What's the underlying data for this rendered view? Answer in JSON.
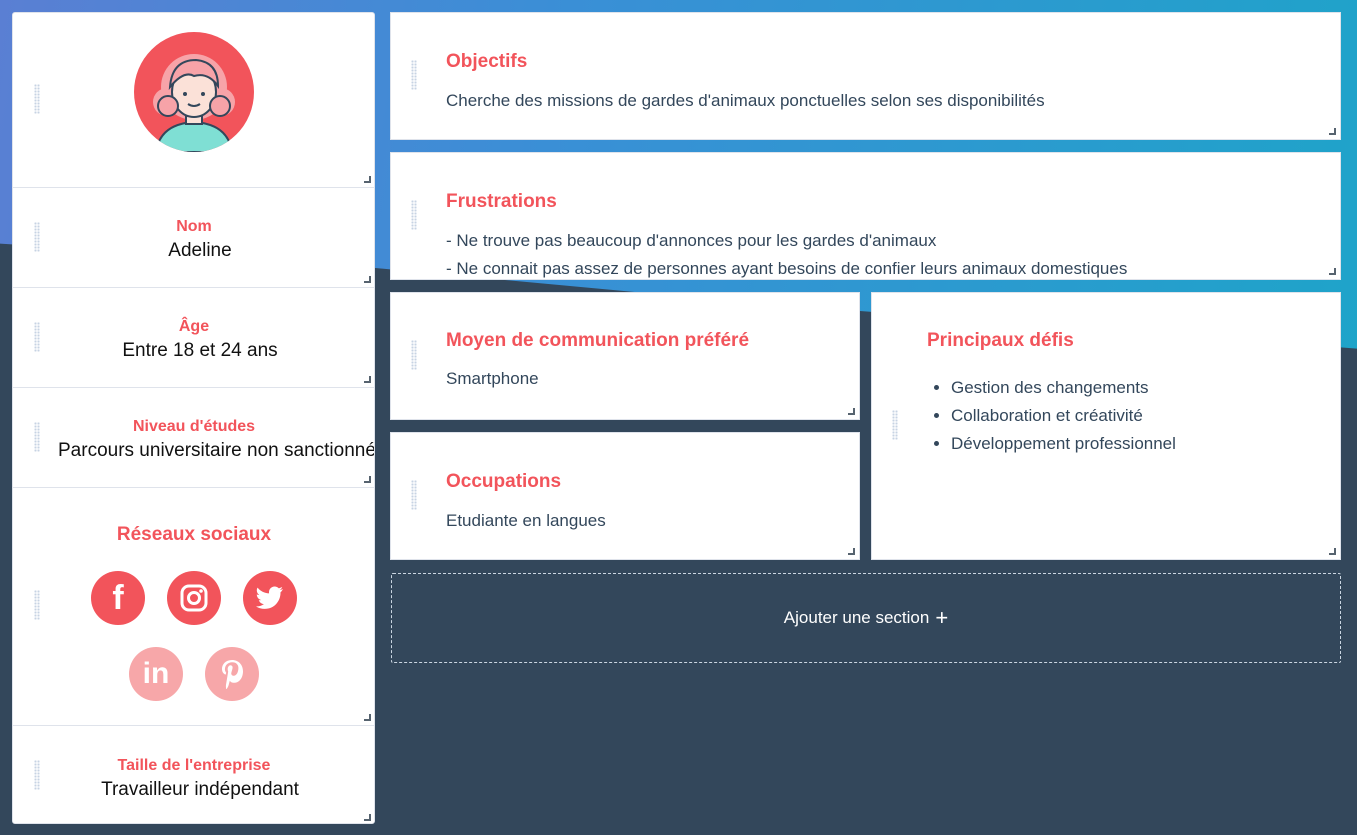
{
  "profile": {
    "avatar_icon": "woman-avatar-icon",
    "name_label": "Nom",
    "name_value": "Adeline",
    "age_label": "Âge",
    "age_value": "Entre 18 et 24 ans",
    "education_label": "Niveau d'études",
    "education_value": "Parcours universitaire non sanctionné",
    "social_label": "Réseaux sociaux",
    "social_networks": [
      {
        "name": "facebook",
        "glyph": "f",
        "active": true
      },
      {
        "name": "instagram",
        "glyph": "◎",
        "active": true
      },
      {
        "name": "twitter",
        "glyph": "🐦",
        "active": true
      },
      {
        "name": "linkedin",
        "glyph": "in",
        "active": false
      },
      {
        "name": "pinterest",
        "glyph": "p",
        "active": false
      }
    ],
    "company_label": "Taille de l'entreprise",
    "company_value": "Travailleur indépendant"
  },
  "sections": {
    "objectives": {
      "title": "Objectifs",
      "text": "Cherche des missions de gardes d'animaux ponctuelles selon ses disponibilités"
    },
    "frustrations": {
      "title": "Frustrations",
      "lines": [
        "- Ne trouve pas beaucoup d'annonces pour les gardes d'animaux",
        "- Ne connait pas assez de personnes ayant besoins de confier leurs animaux domestiques"
      ]
    },
    "communication": {
      "title": "Moyen de communication préféré",
      "text": "Smartphone"
    },
    "occupations": {
      "title": "Occupations",
      "text": "Etudiante en langues"
    },
    "challenges": {
      "title": "Principaux défis",
      "items": [
        "Gestion des changements",
        "Collaboration et créativité",
        "Développement professionnel"
      ]
    }
  },
  "add_section": {
    "label": "Ajouter une section",
    "plus": "+"
  },
  "colors": {
    "accent": "#f2545b",
    "dark_bg": "#33475b",
    "blue_bg": "#3a8fd6"
  }
}
